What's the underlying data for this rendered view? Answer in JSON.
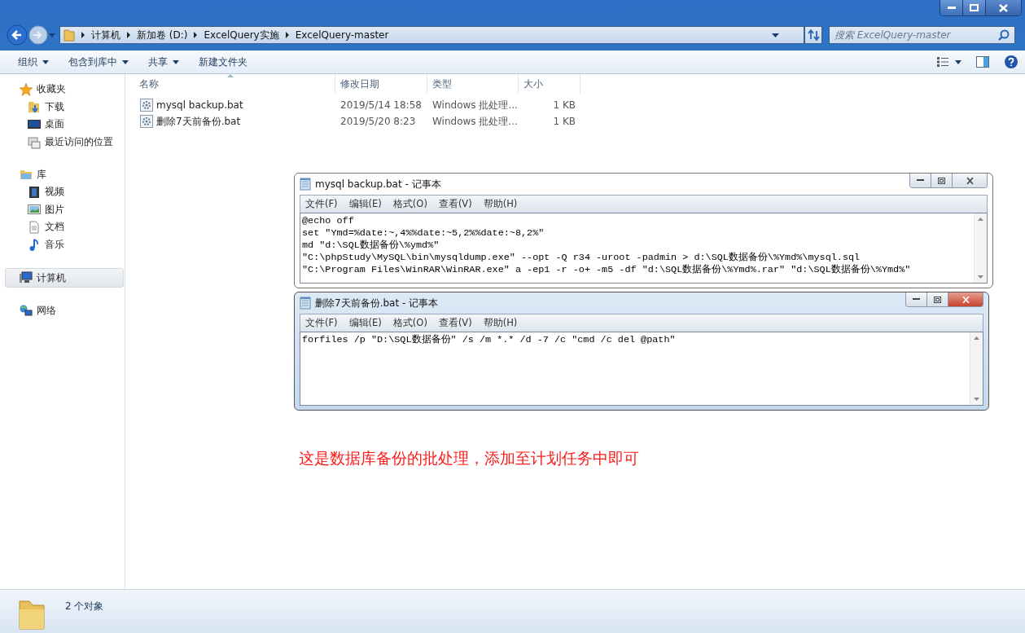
{
  "address_bar": {
    "crumbs": [
      "计算机",
      "新加卷 (D:)",
      "ExcelQuery实施",
      "ExcelQuery-master"
    ]
  },
  "search": {
    "placeholder": "搜索 ExcelQuery-master"
  },
  "toolbar": {
    "buttons": [
      {
        "label": "组织",
        "dropdown": true
      },
      {
        "label": "包含到库中",
        "dropdown": true
      },
      {
        "label": "共享",
        "dropdown": true
      },
      {
        "label": "新建文件夹",
        "dropdown": false
      }
    ]
  },
  "sidebar": {
    "groups": [
      {
        "label": "收藏夹",
        "selected": false,
        "children": [
          {
            "label": "下载"
          },
          {
            "label": "桌面"
          },
          {
            "label": "最近访问的位置"
          }
        ]
      },
      {
        "label": "库",
        "selected": false,
        "children": [
          {
            "label": "视频"
          },
          {
            "label": "图片"
          },
          {
            "label": "文档"
          },
          {
            "label": "音乐"
          }
        ]
      },
      {
        "label": "计算机",
        "selected": true
      },
      {
        "label": "网络",
        "selected": false
      }
    ]
  },
  "file_list": {
    "columns": [
      {
        "label": "名称",
        "sorted": true
      },
      {
        "label": "修改日期",
        "sorted": false
      },
      {
        "label": "类型",
        "sorted": false
      },
      {
        "label": "大小",
        "sorted": false
      }
    ],
    "rows": [
      {
        "name": "mysql backup.bat",
        "modified": "2019/5/14 18:58",
        "type": "Windows 批处理...",
        "size": "1 KB"
      },
      {
        "name": "删除7天前备份.bat",
        "modified": "2019/5/20 8:23",
        "type": "Windows 批处理...",
        "size": "1 KB"
      }
    ]
  },
  "notepads": [
    {
      "title": "mysql backup.bat - 记事本",
      "menu": [
        "文件(F)",
        "编辑(E)",
        "格式(O)",
        "查看(V)",
        "帮助(H)"
      ],
      "lines": [
        "@echo off",
        "set \"Ymd=%date:~,4%%date:~5,2%%date:~8,2%\"",
        "md \"d:\\SQL数据备份\\%ymd%\"",
        "\"C:\\phpStudy\\MySQL\\bin\\mysqldump.exe\" --opt -Q r34 -uroot -padmin > d:\\SQL数据备份\\%Ymd%\\mysql.sql",
        "\"C:\\Program Files\\WinRAR\\WinRAR.exe\" a -ep1 -r -o+ -m5 -df \"d:\\SQL数据备份\\%Ymd%.rar\" \"d:\\SQL数据备份\\%Ymd%\""
      ]
    },
    {
      "title": "删除7天前备份.bat - 记事本",
      "menu": [
        "文件(F)",
        "编辑(E)",
        "格式(O)",
        "查看(V)",
        "帮助(H)"
      ],
      "lines": [
        "forfiles /p \"D:\\SQL数据备份\" /s /m *.* /d -7 /c \"cmd /c del @path\""
      ]
    }
  ],
  "annotation": "这是数据库备份的批处理，添加至计划任务中即可",
  "status_bar": {
    "count": "2 个对象"
  }
}
